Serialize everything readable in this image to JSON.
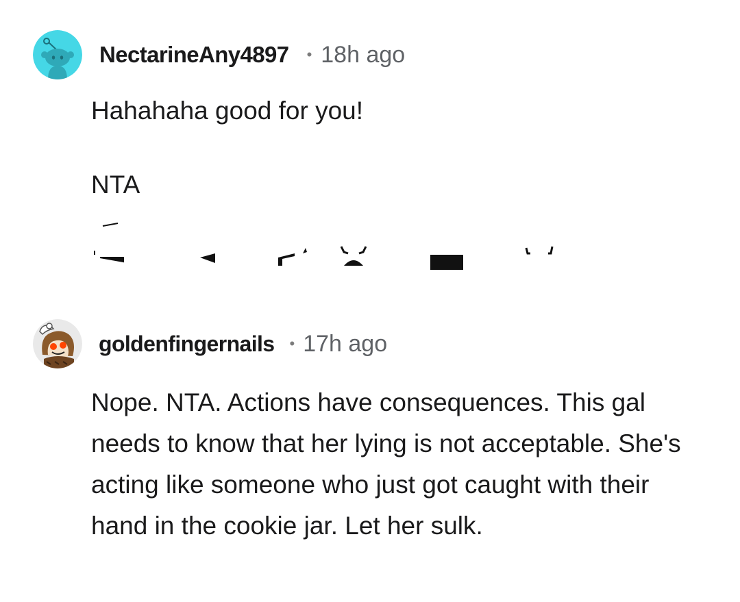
{
  "comments": [
    {
      "username": "NectarineAny4897",
      "separator": "•",
      "timestamp": "18h ago",
      "body_line1": "Hahahaha good for you!",
      "body_line2": "NTA",
      "avatar_icon": "snoo-avatar-teal-icon",
      "avatar_color": "#45d7e6"
    },
    {
      "username": "goldenfingernails",
      "separator": "•",
      "timestamp": "17h ago",
      "body": "Nope. NTA. Actions have consequences. This gal needs to know that her lying is not acceptable. She's acting like someone who just got caught with their hand in the cookie jar. Let her sulk.",
      "avatar_icon": "snoo-avatar-owl-costume-icon",
      "avatar_color": "#e9e9e9"
    }
  ]
}
